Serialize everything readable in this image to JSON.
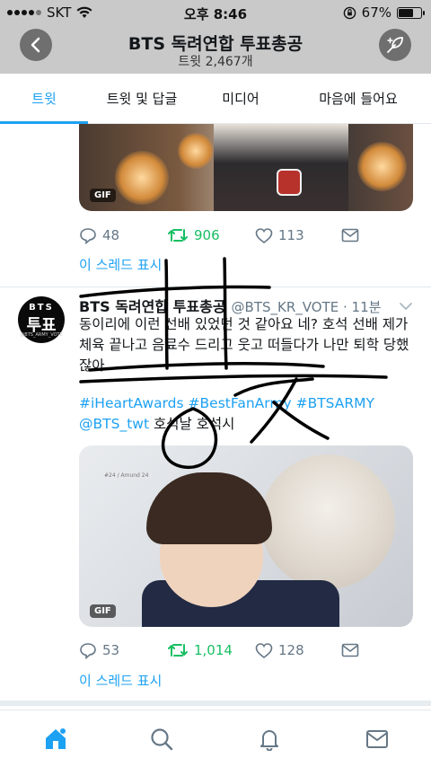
{
  "status_bar": {
    "carrier": "SKT",
    "time": "오후 8:46",
    "battery_percent_label": "67%",
    "battery_level": 0.67
  },
  "header": {
    "title": "BTS 독려연합 투표총공",
    "subtitle": "트윗 2,467개"
  },
  "tabs": [
    {
      "label": "트윗",
      "active": true
    },
    {
      "label": "트윗 및 답글",
      "active": false
    },
    {
      "label": "미디어",
      "active": false
    },
    {
      "label": "마음에 들어요",
      "active": false
    }
  ],
  "tweet1": {
    "media_badge": "GIF",
    "replies": "48",
    "retweets": "906",
    "likes": "113",
    "thread_link": "이 스레드 표시"
  },
  "tweet2": {
    "avatar": {
      "line1": "BTS",
      "line2": "투표",
      "line3": "@BTS_ARMY_VOTE"
    },
    "name": "BTS 독려연합 투표총공",
    "handle": "@BTS_KR_VOTE · 11분",
    "text": "동이리에 이런 선배 있었던 것 같아요 네? 호석 선배 제가 체육 끝나고 음료수 드리고 웃고 떠들다가 나만 퇴학 당했잖아",
    "hashtags": [
      "#iHeartAwards",
      "#BestFanArmy",
      "#BTSARMY"
    ],
    "mention": "@BTS_twt",
    "tail_text": " 호석날 호석시",
    "media_caption": "#24 / Amund 24",
    "media_badge": "GIF",
    "replies": "53",
    "retweets": "1,014",
    "likes": "128",
    "thread_link": "이 스레드 표시"
  },
  "colors": {
    "accent": "#1da1f2",
    "retweet": "#17bf63",
    "muted": "#657786",
    "header_bg": "#c9c9c9"
  },
  "icons": [
    "back-arrow-icon",
    "compose-feather-icon",
    "reply-icon",
    "retweet-icon",
    "like-icon",
    "direct-message-icon",
    "chevron-down-icon",
    "home-icon",
    "search-icon",
    "notifications-icon",
    "messages-icon"
  ]
}
